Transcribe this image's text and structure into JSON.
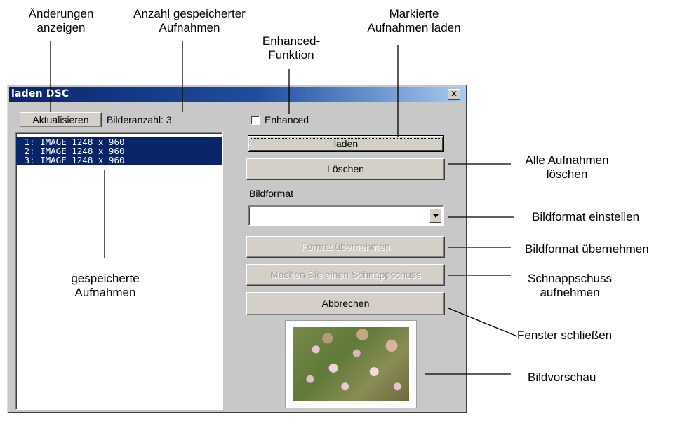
{
  "annotations": {
    "changes": [
      "Änderungen",
      "anzeigen"
    ],
    "count": [
      "Anzahl gespeicherter",
      "Aufnahmen"
    ],
    "enhanced": [
      "Enhanced-",
      "Funktion"
    ],
    "load_marked": [
      "Markierte",
      "Aufnahmen laden"
    ],
    "delete_all": [
      "Alle Aufnahmen",
      "löschen"
    ],
    "set_format": "Bildformat einstellen",
    "apply_format": "Bildformat übernehmen",
    "snapshot": [
      "Schnappschuss",
      "aufnehmen"
    ],
    "close_window": "Fenster schließen",
    "preview": "Bildvorschau",
    "saved": [
      "gespeicherte",
      "Aufnahmen"
    ]
  },
  "window": {
    "title": "laden DSC",
    "close_glyph": "✕"
  },
  "toolbar": {
    "refresh_label": "Aktualisieren",
    "image_count": "Bilderanzahl: 3"
  },
  "image_list": [
    " 1: IMAGE 1248 x 960",
    " 2: IMAGE 1248 x 960",
    " 3: IMAGE 1248 x 960"
  ],
  "controls": {
    "enhanced_label": "Enhanced",
    "enhanced_checked": false,
    "load_label": "laden",
    "delete_label": "Löschen",
    "format_label": "Bildformat",
    "format_value": "",
    "apply_format_label": "Format übernehmen",
    "snapshot_label": "Machen Sie einen Schnappschuss",
    "cancel_label": "Abbrechen"
  },
  "colors": {
    "titlebar": "#0a246a",
    "selection": "#0a246a",
    "dialog_bg": "#c8c8c8"
  }
}
